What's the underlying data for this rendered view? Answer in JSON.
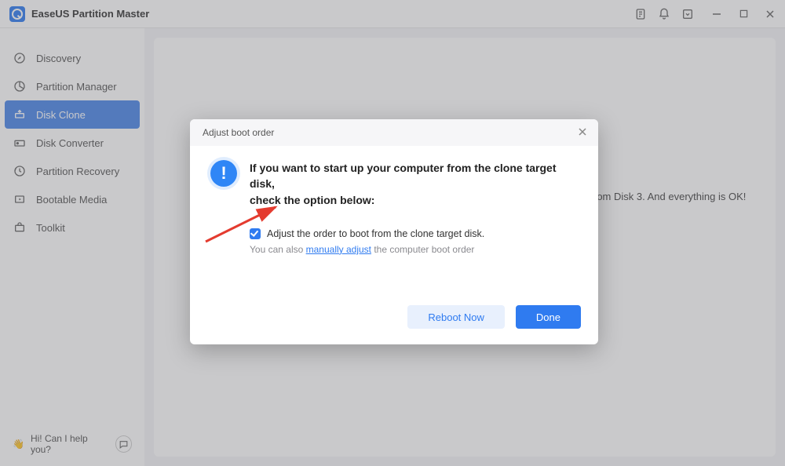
{
  "app": {
    "title": "EaseUS Partition Master"
  },
  "sidebar": {
    "items": [
      {
        "label": "Discovery",
        "icon": "compass-icon"
      },
      {
        "label": "Partition Manager",
        "icon": "pie-icon"
      },
      {
        "label": "Disk Clone",
        "icon": "clone-icon"
      },
      {
        "label": "Disk Converter",
        "icon": "convert-icon"
      },
      {
        "label": "Partition Recovery",
        "icon": "recovery-icon"
      },
      {
        "label": "Bootable Media",
        "icon": "media-icon"
      },
      {
        "label": "Toolkit",
        "icon": "toolkit-icon"
      }
    ],
    "active_index": 2,
    "footer": {
      "emoji": "👋",
      "text": "Hi! Can I help you?"
    }
  },
  "background": {
    "peek_text": "rom Disk 3. And everything is OK!"
  },
  "modal": {
    "title": "Adjust boot order",
    "heading_l1": "If you want to start up your computer from the clone target disk,",
    "heading_l2": "check the option below:",
    "checkbox_label": "Adjust the order to boot from the clone target disk.",
    "checkbox_checked": true,
    "hint_prefix": "You can also ",
    "hint_link": "manually adjust",
    "hint_suffix": " the computer boot order",
    "reboot_label": "Reboot Now",
    "done_label": "Done"
  }
}
